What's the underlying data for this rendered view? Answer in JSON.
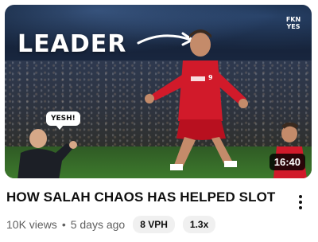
{
  "video": {
    "thumbnail_overlay_text": "LEADER",
    "thumbnail_logo_text": "FKN YES",
    "speech_bubble_text": "YESH!",
    "duration": "16:40",
    "title": "HOW SALAH CHAOS HAS HELPED SLOT",
    "views": "10K views",
    "age": "5 days ago",
    "separator": "•",
    "vph_badge": "8 VPH",
    "multiplier_badge": "1.3x"
  },
  "colors": {
    "kit_red": "#d11a2a",
    "title_text": "#0f0f0f",
    "meta_text": "#606060",
    "pill_bg": "#f0f0f0"
  }
}
